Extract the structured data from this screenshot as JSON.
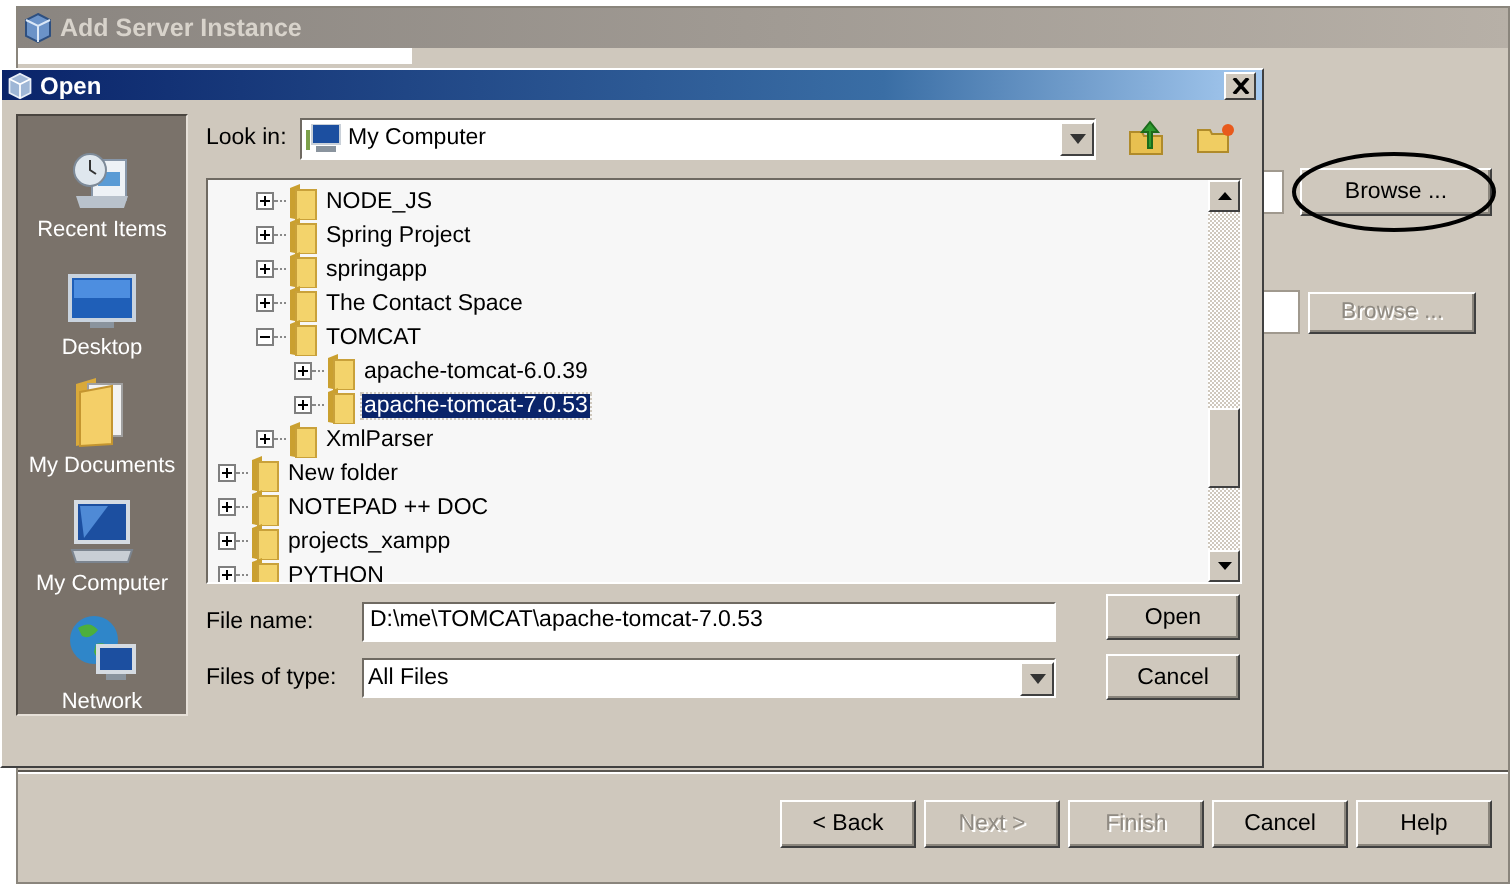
{
  "background_window": {
    "title": "Add Server Instance",
    "active": false,
    "browse_buttons": [
      {
        "label": "Browse ...",
        "disabled": false,
        "circled": true
      },
      {
        "label": "Browse ...",
        "disabled": true,
        "circled": false
      }
    ],
    "buttons": [
      {
        "label": "< Back",
        "disabled": false
      },
      {
        "label": "Next >",
        "disabled": true
      },
      {
        "label": "Finish",
        "disabled": true
      },
      {
        "label": "Cancel",
        "disabled": false
      },
      {
        "label": "Help",
        "disabled": false
      }
    ]
  },
  "dialog": {
    "title": "Open",
    "places": [
      {
        "label": "Recent Items",
        "kind": "recent"
      },
      {
        "label": "Desktop",
        "kind": "desktop"
      },
      {
        "label": "My Documents",
        "kind": "documents"
      },
      {
        "label": "My Computer",
        "kind": "computer"
      },
      {
        "label": "Network",
        "kind": "network"
      }
    ],
    "look_in": {
      "label": "Look in:",
      "value": "My Computer"
    },
    "tree": [
      {
        "kind": "continuation",
        "children": [
          {
            "kind": "folder",
            "label": "NODE_JS",
            "expanded": false,
            "selected": false
          },
          {
            "kind": "folder",
            "label": "Spring Project",
            "expanded": false,
            "selected": false
          },
          {
            "kind": "folder",
            "label": "springapp",
            "expanded": false,
            "selected": false
          },
          {
            "kind": "folder",
            "label": "The Contact Space",
            "expanded": false,
            "selected": false
          },
          {
            "kind": "folder",
            "label": "TOMCAT",
            "expanded": true,
            "selected": false,
            "children": [
              {
                "kind": "folder",
                "label": "apache-tomcat-6.0.39",
                "expanded": false,
                "selected": false
              },
              {
                "kind": "folder",
                "label": "apache-tomcat-7.0.53",
                "expanded": false,
                "selected": true
              }
            ]
          },
          {
            "kind": "folder",
            "label": "XmlParser",
            "expanded": false,
            "selected": false
          }
        ]
      },
      {
        "kind": "folder",
        "label": "New folder",
        "expanded": false,
        "selected": false
      },
      {
        "kind": "folder",
        "label": "NOTEPAD ++ DOC",
        "expanded": false,
        "selected": false
      },
      {
        "kind": "folder",
        "label": "projects_xampp",
        "expanded": false,
        "selected": false
      },
      {
        "kind": "folder",
        "label": "PYTHON",
        "expanded": false,
        "selected": false
      }
    ],
    "file_name": {
      "label": "File name:",
      "value": "D:\\me\\TOMCAT\\apache-tomcat-7.0.53"
    },
    "files_of_type": {
      "label": "Files of type:",
      "value": "All Files"
    },
    "buttons": [
      "Open",
      "Cancel"
    ]
  }
}
